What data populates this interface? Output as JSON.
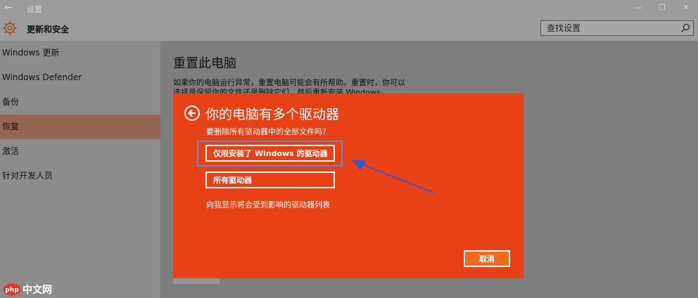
{
  "window": {
    "title": "设置",
    "controls": {
      "minimize": "—",
      "restore": "❐",
      "close": "✕"
    }
  },
  "header": {
    "section_title": "更新和安全",
    "search_placeholder": "查找设置"
  },
  "sidebar": {
    "items": [
      {
        "label": "Windows 更新",
        "active": false
      },
      {
        "label": "Windows Defender",
        "active": false
      },
      {
        "label": "备份",
        "active": false
      },
      {
        "label": "恢复",
        "active": true
      },
      {
        "label": "激活",
        "active": false
      },
      {
        "label": "针对开发人员",
        "active": false
      }
    ]
  },
  "content": {
    "title": "重置此电脑",
    "description": "如果你的电脑运行异常，重置电脑可能会有所帮助。重置时，你可以选择是保留你的文件还是删除它们，然后重新安装 Windows。"
  },
  "dialog": {
    "title": "你的电脑有多个驱动器",
    "question": "要删除所有驱动器中的全部文件吗?",
    "option_installed_drive": "仅限安装了 Windows 的驱动器",
    "option_all_drives": "所有驱动器",
    "show_affected_link": "向我显示将会受到影响的驱动器列表",
    "cancel": "取消"
  },
  "watermark": {
    "text": "中文网",
    "logo_text": "php"
  },
  "colors": {
    "dialog_bg": "#e84116",
    "cancel_bg": "#ef6b1d",
    "highlight": "#5b8ad6",
    "active_nav": "#946652"
  }
}
